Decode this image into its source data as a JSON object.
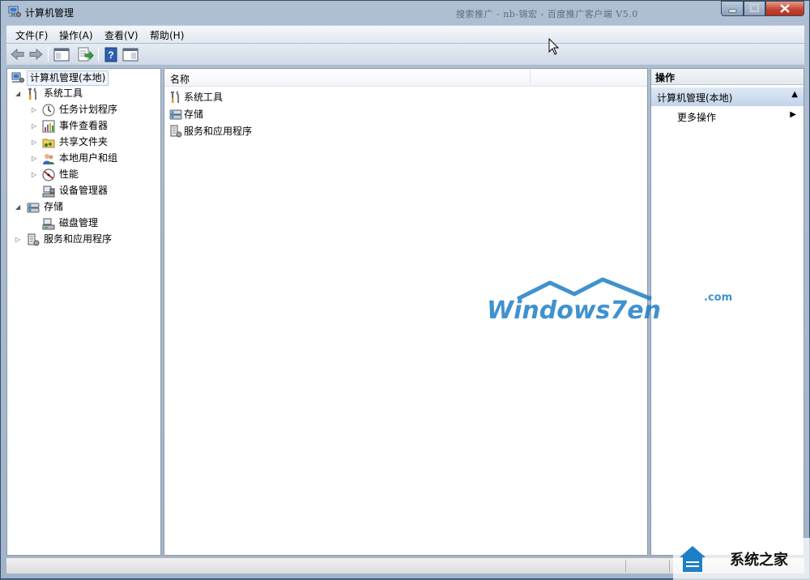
{
  "window": {
    "title": "计算机管理",
    "background_title": "搜索推广 - nb-锦宏 - 百度推广客户端 V5.0"
  },
  "menu": [
    {
      "label": "文件(F)"
    },
    {
      "label": "操作(A)"
    },
    {
      "label": "查看(V)"
    },
    {
      "label": "帮助(H)"
    }
  ],
  "toolbar": {
    "buttons": [
      "back-icon",
      "forward-icon",
      "show-tree-icon",
      "export-list-icon",
      "help-icon",
      "action-pane-icon"
    ]
  },
  "tree": {
    "root": "计算机管理(本地)",
    "system_tools": "系统工具",
    "task_scheduler": "任务计划程序",
    "event_viewer": "事件查看器",
    "shared_folders": "共享文件夹",
    "local_users": "本地用户和组",
    "performance": "性能",
    "device_manager": "设备管理器",
    "storage": "存储",
    "disk_management": "磁盘管理",
    "services_apps": "服务和应用程序"
  },
  "list": {
    "column_name": "名称",
    "items": [
      {
        "label": "系统工具",
        "icon": "tools-icon"
      },
      {
        "label": "存储",
        "icon": "storage-icon"
      },
      {
        "label": "服务和应用程序",
        "icon": "services-icon"
      }
    ]
  },
  "actions": {
    "header": "操作",
    "group": "计算机管理(本地)",
    "more": "更多操作"
  },
  "watermarks": {
    "logo_text": "Windows7en",
    "logo_domain": ".com",
    "site_name": "系统之家"
  }
}
